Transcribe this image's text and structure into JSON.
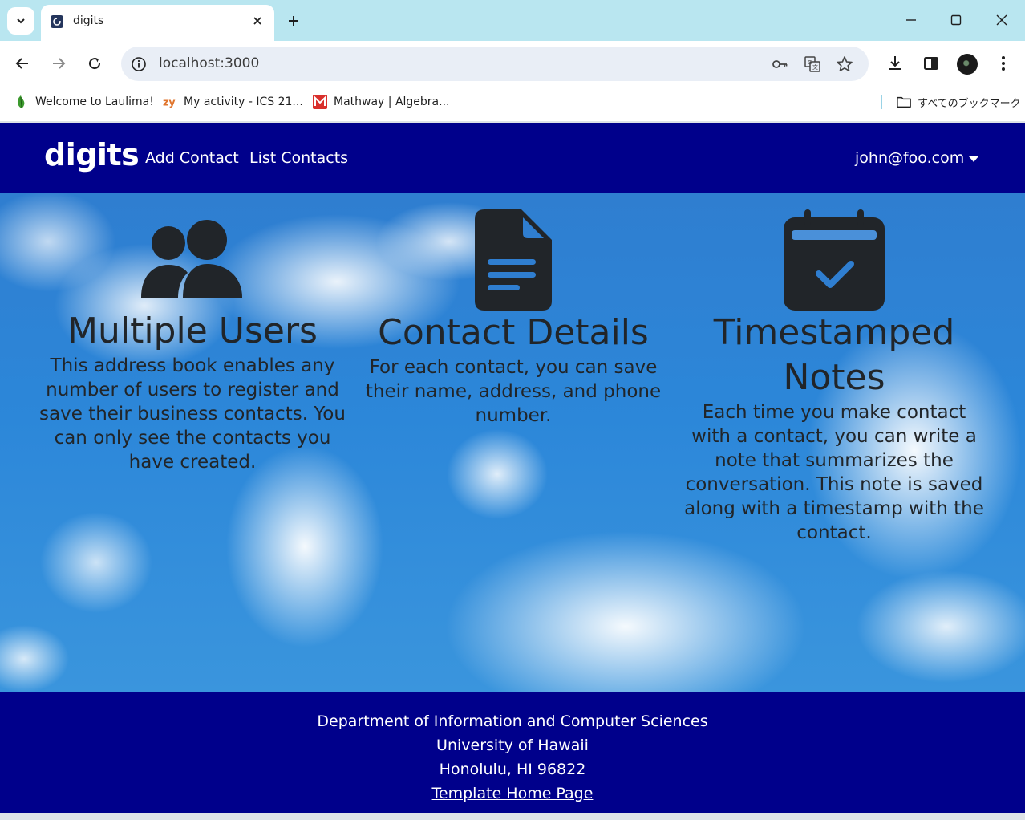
{
  "browser": {
    "tab_title": "digits",
    "url": "localhost:3000",
    "bookmarks": [
      {
        "label": "Welcome to Laulima!",
        "icon": "laulima-leaf-icon"
      },
      {
        "label": "My activity - ICS 21...",
        "icon": "zybooks-icon"
      },
      {
        "label": "Mathway | Algebra...",
        "icon": "mathway-icon"
      }
    ],
    "all_bookmarks_label": "すべてのブックマーク"
  },
  "navbar": {
    "brand": "digits",
    "links": [
      "Add Contact",
      "List Contacts"
    ],
    "user": "john@foo.com",
    "color": "#00008b"
  },
  "features": [
    {
      "icon": "users-icon",
      "title": "Multiple Users",
      "text": "This address book enables any number of users to register and save their business contacts. You can only see the contacts you have created."
    },
    {
      "icon": "file-text-icon",
      "title": "Contact Details",
      "text": "For each contact, you can save their name, address, and phone number."
    },
    {
      "icon": "calendar-check-icon",
      "title": "Timestamped Notes",
      "text": "Each time you make contact with a contact, you can write a note that summarizes the conversation. This note is saved along with a timestamp with the contact."
    }
  ],
  "footer": {
    "lines": [
      "Department of Information and Computer Sciences",
      "University of Hawaii",
      "Honolulu, HI 96822"
    ],
    "link": "Template Home Page"
  }
}
